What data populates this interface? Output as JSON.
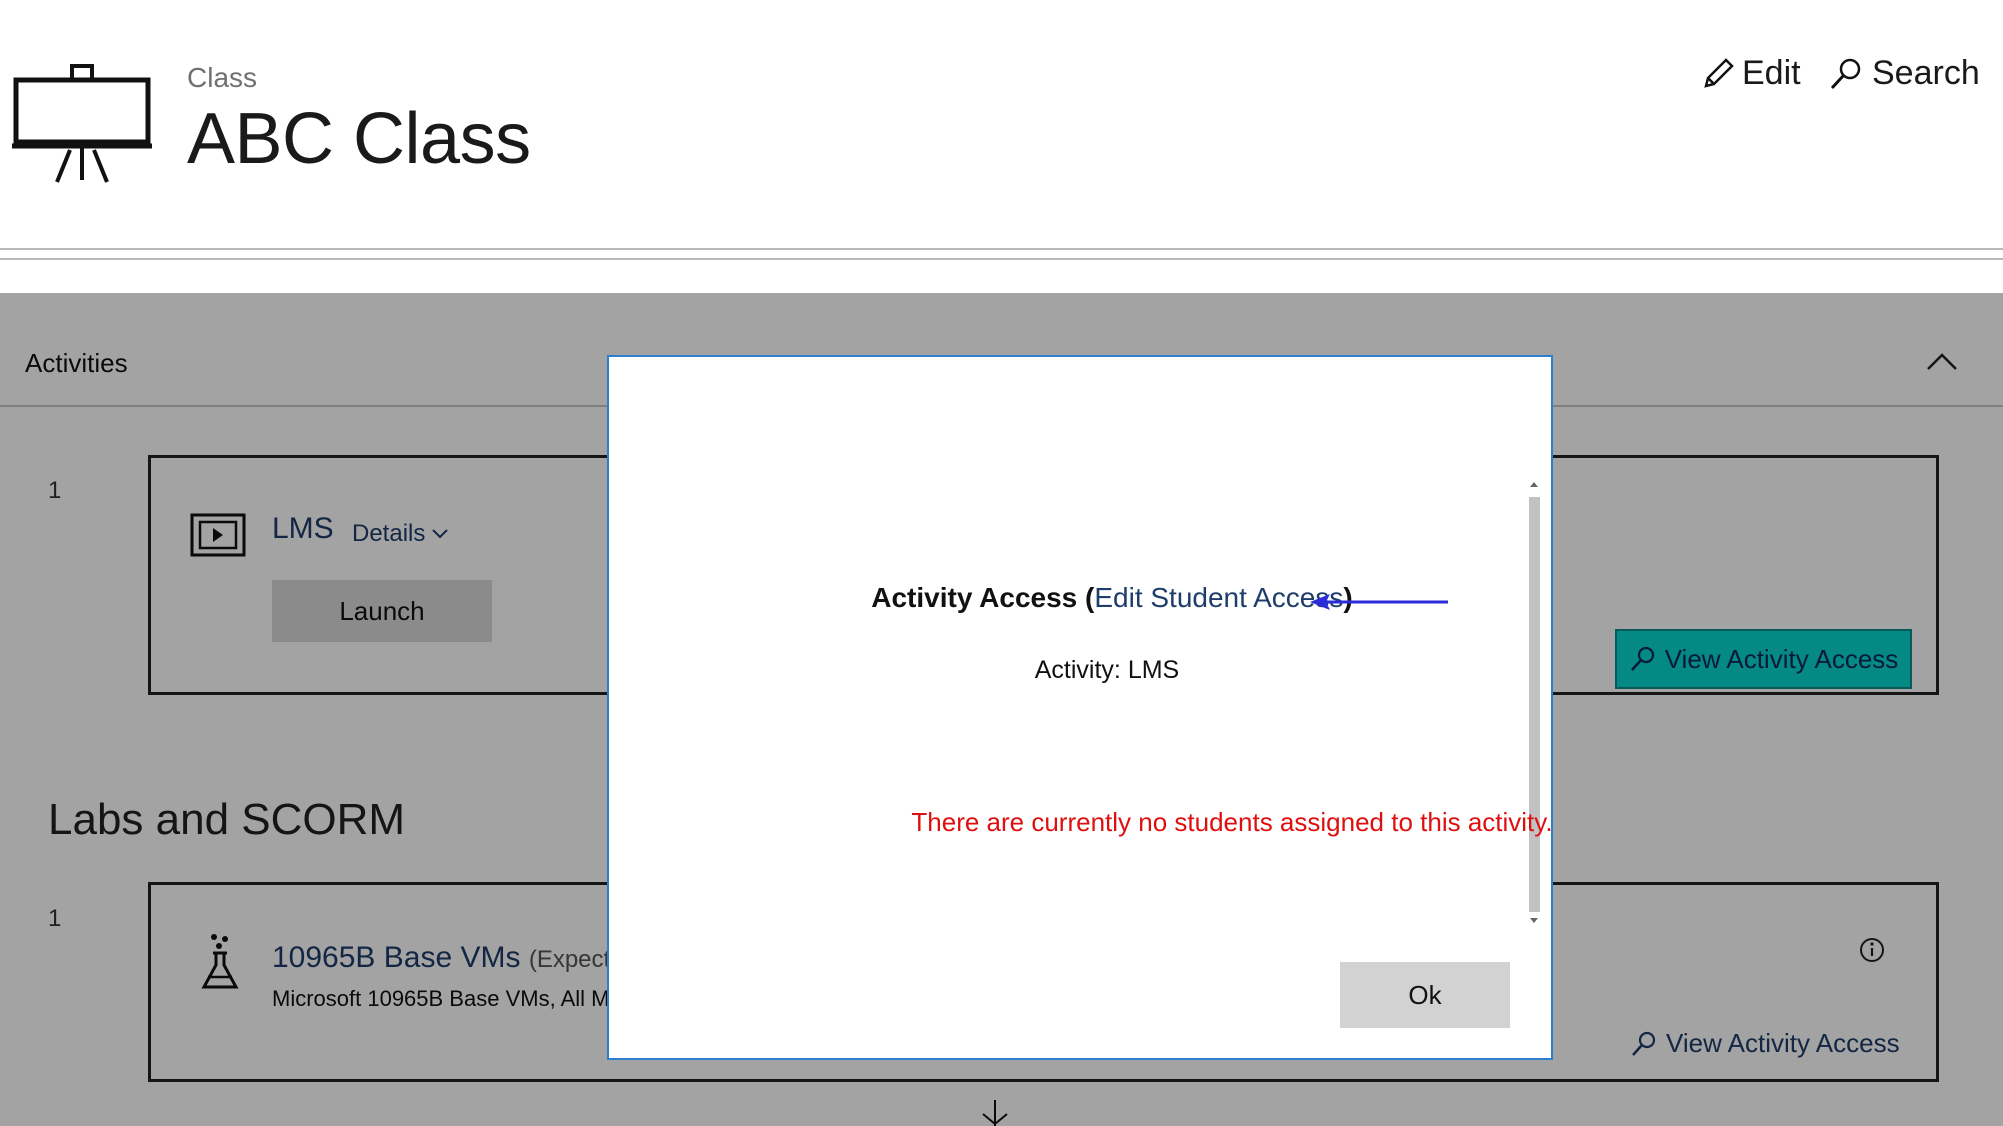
{
  "header": {
    "breadcrumb": "Class",
    "title": "ABC Class",
    "edit_label": "Edit",
    "search_label": "Search"
  },
  "activities": {
    "section_label": "Activities",
    "item_number": "1",
    "activity_name": "LMS",
    "details_label": "Details",
    "launch_label": "Launch",
    "view_access_label": "View Activity Access"
  },
  "labs": {
    "heading": "Labs and SCORM",
    "item_number": "1",
    "lab_name": "10965B Base VMs",
    "lab_suffix": "(Expected",
    "lab_description": "Microsoft 10965B Base VMs, All M",
    "view_access_label": "View Activity Access"
  },
  "modal": {
    "heading_prefix": "Activity Access (",
    "heading_link": "Edit Student Access",
    "heading_suffix": ")",
    "activity_line": "Activity: LMS",
    "empty_message": "There are currently no students assigned to this activity.",
    "ok_label": "Ok"
  },
  "colors": {
    "accent_teal": "#07d6d0",
    "link_blue": "#1e3d6b",
    "error_red": "#e00f0f",
    "modal_border": "#2e7fd0",
    "callout_arrow": "#2b2bd9"
  },
  "icons": [
    "presentation-easel-icon",
    "pencil-icon",
    "search-icon",
    "chevron-up-icon",
    "video-play-icon",
    "chevron-down-icon",
    "flask-icon",
    "info-icon",
    "arrow-down-icon"
  ]
}
